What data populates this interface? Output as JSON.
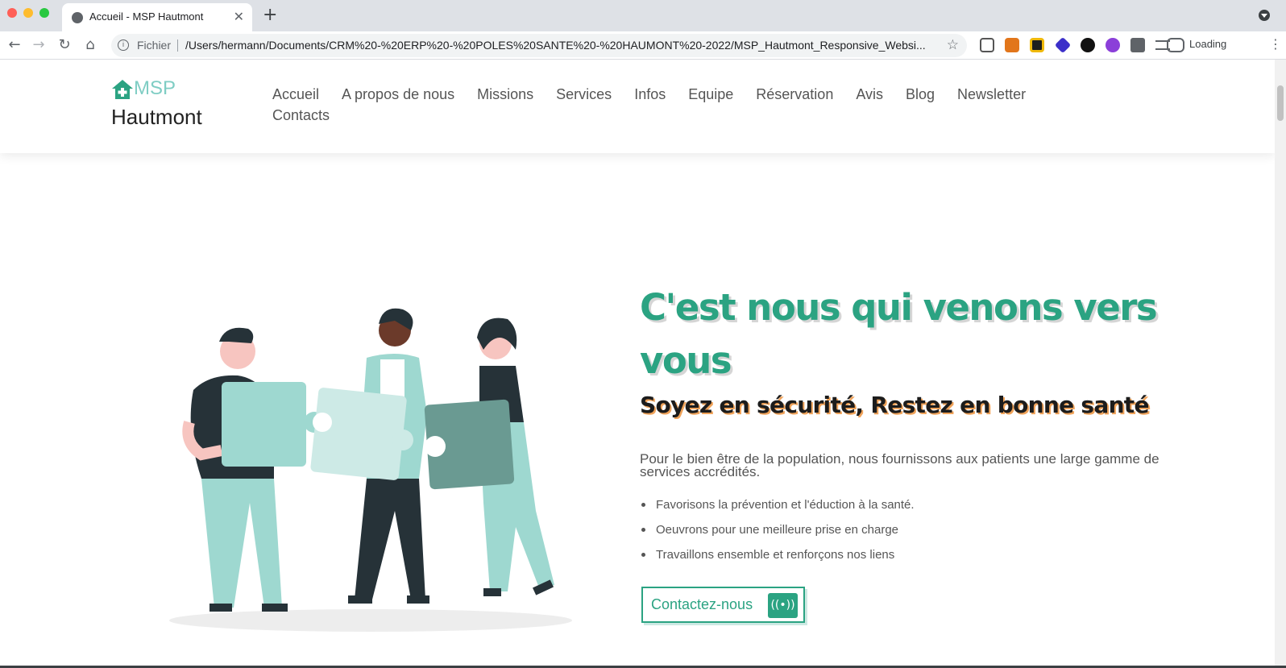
{
  "browser": {
    "tab_title": "Accueil - MSP Hautmont",
    "omnibox_label": "Fichier",
    "url": "/Users/hermann/Documents/CRM%20-%20ERP%20-%20POLES%20SANTE%20-%20HAUMONT%20-2022/MSP_Hautmont_Responsive_Websi...",
    "status": "Loading"
  },
  "header": {
    "logo_short": "MSP",
    "logo_name": "Hautmont",
    "nav": [
      "Accueil",
      "A propos de nous",
      "Missions",
      "Services",
      "Infos",
      "Equipe",
      "Réservation",
      "Avis",
      "Blog",
      "Newsletter",
      "Contacts"
    ]
  },
  "hero": {
    "title": "C'est nous qui venons vers vous",
    "subtitle": "Soyez en sécurité, Restez en bonne santé",
    "description": "Pour le bien être de la population, nous fournissons aux patients une large gamme de services accrédités.",
    "bullets": [
      "Favorisons la prévention et l'éduction à la santé.",
      "Oeuvrons pour une meilleure prise en charge",
      "Travaillons ensemble et renforçons nos liens"
    ],
    "cta_label": "Contactez-nous"
  },
  "colors": {
    "accent": "#2ba382",
    "logo_accent": "#7fcdc4",
    "subtitle_shadow": "#f0a35a"
  }
}
